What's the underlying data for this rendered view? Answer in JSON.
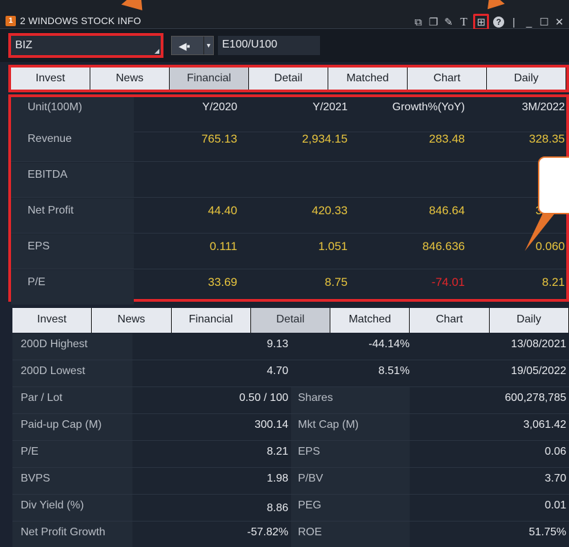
{
  "window": {
    "number": "1",
    "title": "2 WINDOWS STOCK INFO",
    "icons": [
      "popout-icon",
      "copy-icon",
      "pin-icon",
      "text-icon",
      "grid-icon",
      "help-icon",
      "minimize-icon",
      "maximize-icon",
      "close-icon"
    ]
  },
  "toolbar": {
    "symbol": "BIZ",
    "board": "E100/U100"
  },
  "tabs": [
    "Invest",
    "News",
    "Financial",
    "Detail",
    "Matched",
    "Chart",
    "Daily"
  ],
  "financial": {
    "header": {
      "label": "Unit(100M)",
      "c1": "Y/2020",
      "c2": "Y/2021",
      "c3": "Growth%(YoY)",
      "c4": "3M/2022"
    },
    "rows": [
      {
        "label": "Revenue",
        "c1": "765.13",
        "c2": "2,934.15",
        "c3": "283.48",
        "c4": "328.35"
      },
      {
        "label": "EBITDA",
        "c1": "",
        "c2": "",
        "c3": "",
        "c4": ""
      },
      {
        "label": "Net Profit",
        "c1": "44.40",
        "c2": "420.33",
        "c3": "846.64",
        "c4": "34.19"
      },
      {
        "label": "EPS",
        "c1": "0.111",
        "c2": "1.051",
        "c3": "846.636",
        "c4": "0.060"
      },
      {
        "label": "P/E",
        "c1": "33.69",
        "c2": "8.75",
        "c3": "-74.01",
        "c4": "8.21"
      }
    ]
  },
  "detail": {
    "highest": {
      "label": "200D Highest",
      "price": "9.13",
      "pct": "-44.14%",
      "date": "13/08/2021"
    },
    "lowest": {
      "label": "200D Lowest",
      "price": "4.70",
      "pct": "8.51%",
      "date": "19/05/2022"
    },
    "rows": [
      {
        "l1": "Par / Lot",
        "v1": "0.50  / 100",
        "l2": "Shares",
        "v2": "600,278,785"
      },
      {
        "l1": "Paid-up Cap (M)",
        "v1": "300.14",
        "l2": "Mkt Cap (M)",
        "v2": "3,061.42"
      },
      {
        "l1": "P/E",
        "v1": "8.21",
        "l2": "EPS",
        "v2": "0.06"
      },
      {
        "l1": "BVPS",
        "v1": "1.98",
        "l2": "P/BV",
        "v2": "3.70"
      },
      {
        "l1": "Div Yield (%)",
        "v1": "8.86",
        "l2": "PEG",
        "v2": "0.01"
      },
      {
        "l1": "Net Profit Growth",
        "v1": "-57.82%",
        "l2": "ROE",
        "v2": "51.75%"
      }
    ]
  }
}
